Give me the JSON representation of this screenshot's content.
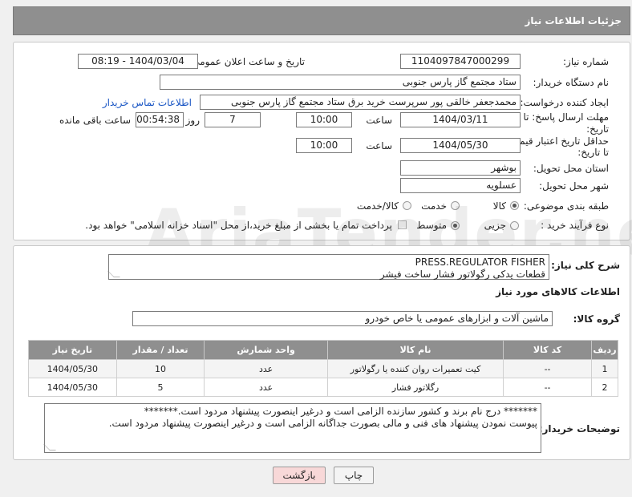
{
  "header": {
    "title": "جزئیات اطلاعات نیاز"
  },
  "form": {
    "need_number_label": "شماره نیاز:",
    "need_number": "1104097847000299",
    "announce_label": "تاریخ و ساعت اعلان عمومی:",
    "announce_value": "1404/03/04 - 08:19",
    "buyer_org_label": "نام دستگاه خریدار:",
    "buyer_org": "ستاد مجتمع گاز پارس جنوبی",
    "requester_label": "ایجاد کننده درخواست:",
    "requester": "محمدجعفر خالقی پور سرپرست خرید برق ستاد مجتمع گاز پارس جنوبی",
    "buyer_contact_link": "اطلاعات تماس خریدار",
    "deadline_label_1": "مهلت ارسال پاسخ: تا",
    "deadline_label_2": "تاریخ:",
    "deadline_date": "1404/03/11",
    "time_label": "ساعت",
    "deadline_time": "10:00",
    "days": "7",
    "days_label": "روز و",
    "remaining": "00:54:38",
    "remaining_label": "ساعت باقی مانده",
    "validity_label_1": "حداقل تاریخ اعتبار قیمت:",
    "validity_label_2": "تا تاریخ:",
    "validity_date": "1404/05/30",
    "validity_time": "10:00",
    "province_label": "استان محل تحویل:",
    "province": "بوشهر",
    "city_label": "شهر محل تحویل:",
    "city": "عسلویه",
    "category_label": "طبقه بندی موضوعی:",
    "category_options": [
      "کالا",
      "خدمت",
      "کالا/خدمت"
    ],
    "category_selected": "کالا",
    "process_label": "نوع فرآیند خرید :",
    "process_options": [
      "جزیی",
      "متوسط"
    ],
    "process_selected": "متوسط",
    "payment_note": "پرداخت تمام یا بخشی از مبلغ خرید،از محل \"اسناد خزانه اسلامی\" خواهد بود."
  },
  "details": {
    "summary_label": "شرح کلی نیاز:",
    "summary_line1": "PRESS.REGULATOR    FISHER",
    "summary_line2": "قطعات یدکی رگولاتور فشار ساخت فیشر",
    "items_info_label": "اطلاعات کالاهای مورد نیاز",
    "group_label": "گروه کالا:",
    "group_value": "ماشین آلات و ابزارهای عمومی یا خاص خودرو",
    "table": {
      "headers": [
        "ردیف",
        "کد کالا",
        "نام کالا",
        "واحد شمارش",
        "تعداد / مقدار",
        "تاریخ نیاز"
      ],
      "rows": [
        [
          "1",
          "--",
          "کیت تعمیرات روان کننده یا رگولاتور",
          "عدد",
          "10",
          "1404/05/30"
        ],
        [
          "2",
          "--",
          "رگلاتور فشار",
          "عدد",
          "5",
          "1404/05/30"
        ]
      ]
    },
    "buyer_notes_label": "توضیحات خریدار:",
    "buyer_notes_line1": "******* درج نام برند و کشور سازنده الزامی است و درغیر اینصورت پیشنهاد مردود است.*******",
    "buyer_notes_line2": "پیوست نمودن پیشنهاد های فنی و مالی بصورت جداگانه الزامی است و درغیر اینصورت پیشنهاد مردود است."
  },
  "buttons": {
    "print": "چاپ",
    "back": "بازگشت"
  },
  "watermark": "AriaTender.neT",
  "colors": {
    "header_bg": "#8f8f8f",
    "link": "#1a56c4",
    "back_button_bg": "#f8d8d8"
  }
}
